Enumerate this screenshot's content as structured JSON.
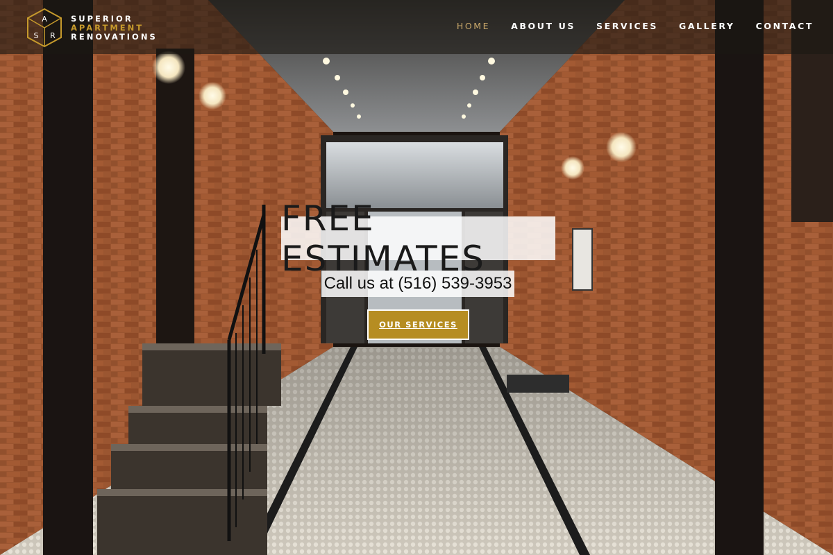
{
  "brand": {
    "line1": "SUPERIOR",
    "line2": "APARTMENT",
    "line3": "RENOVATIONS",
    "monogram": [
      "A",
      "S",
      "R"
    ],
    "accent_color": "#c69a2c",
    "logo_icon": "cube-monogram-icon"
  },
  "nav": {
    "items": [
      {
        "label": "HOME",
        "active": true
      },
      {
        "label": "ABOUT US",
        "active": false
      },
      {
        "label": "SERVICES",
        "active": false
      },
      {
        "label": "GALLERY",
        "active": false
      },
      {
        "label": "CONTACT",
        "active": false
      }
    ],
    "active_color": "#c9a86a"
  },
  "hero": {
    "title": "FREE ESTIMATES",
    "phone_line": "Call us at (516) 539-3953",
    "cta_label": "OUR SERVICES",
    "cta_color": "#b68d22",
    "background": "brick-hallway-photo"
  }
}
